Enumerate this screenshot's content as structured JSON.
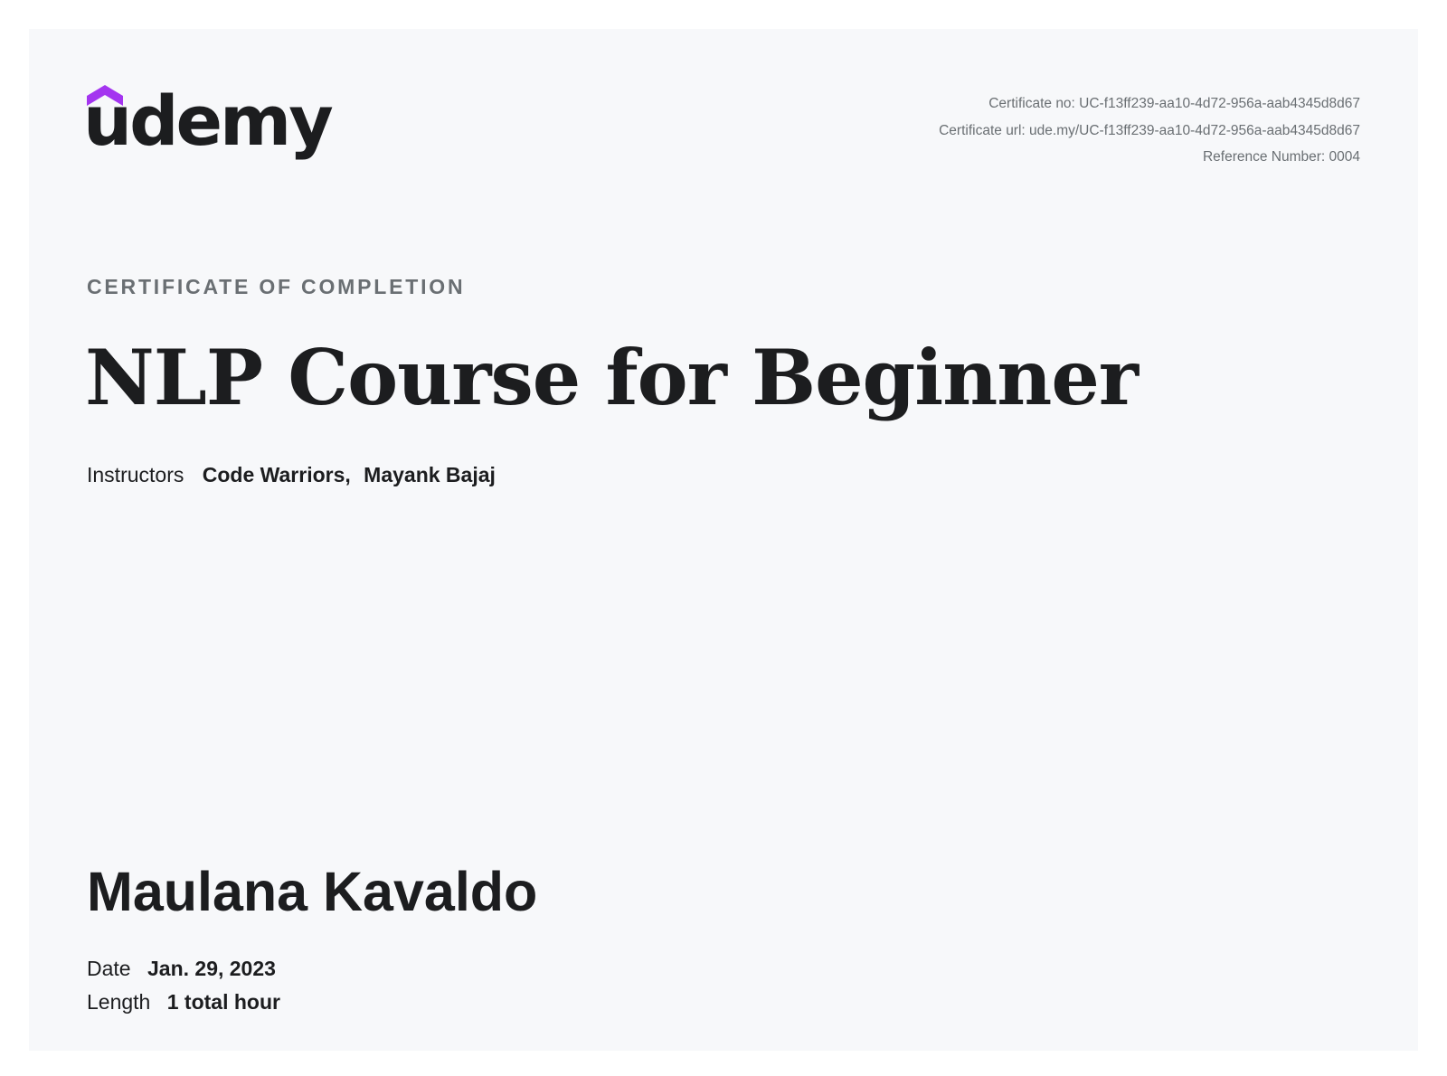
{
  "brand": {
    "logo_text": "udemy",
    "logo_color": "#a435f0",
    "text_color": "#1c1d1f"
  },
  "meta": {
    "certificate_no": "Certificate no: UC-f13ff239-aa10-4d72-956a-aab4345d8d67",
    "certificate_url": "Certificate url: ude.my/UC-f13ff239-aa10-4d72-956a-aab4345d8d67",
    "reference_number": "Reference Number: 0004"
  },
  "eyebrow": "CERTIFICATE OF COMPLETION",
  "course_title": "NLP Course for Beginner",
  "instructors": {
    "label": "Instructors",
    "names": [
      "Code Warriors,",
      "Mayank Bajaj"
    ]
  },
  "recipient_name": "Maulana Kavaldo",
  "details": {
    "date_label": "Date",
    "date_value": "Jan. 29, 2023",
    "length_label": "Length",
    "length_value": "1 total hour"
  }
}
